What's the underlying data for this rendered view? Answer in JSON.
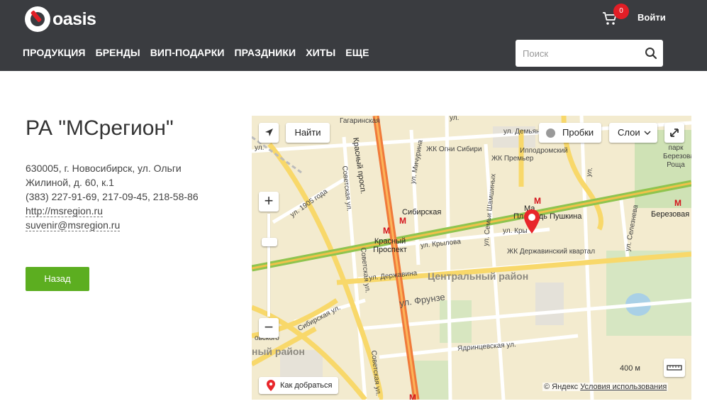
{
  "header": {
    "logo_text": "oasis",
    "cart_count": "0",
    "login_label": "Войти",
    "nav": [
      "ПРОДУКЦИЯ",
      "БРЕНДЫ",
      "ВИП-ПОДАРКИ",
      "ПРАЗДНИКИ",
      "ХИТЫ",
      "ЕЩЕ"
    ],
    "search_placeholder": "Поиск"
  },
  "company": {
    "title": "РА \"МСрегион\"",
    "address_line1": "630005, г. Новосибирск, ул. Ольги",
    "address_line2": "Жилиной, д. 60, к.1",
    "phones": "(383) 227-91-69, 217-09-45, 218-58-86",
    "website": "http://msregion.ru",
    "email": "suvenir@msregion.ru",
    "back_label": "Назад"
  },
  "map": {
    "find_label": "Найти",
    "traffic_label": "Пробки",
    "layers_label": "Слои",
    "route_label": "Как добраться",
    "scale_label": "400 м",
    "copyright": "© Яндекс",
    "terms_label": "Условия использования",
    "district_label": "Центральный район",
    "district2_label": "ный район",
    "streets": {
      "gagarinskaya": "Гагаринская",
      "krasny": "Красный просп.",
      "sibirskaya": "Сибирская",
      "krasny_prospekt": "Красный Проспект",
      "ploshad": "Площадь Пушкина",
      "ploshad_top": "Ма",
      "berezovaya": "Березовая",
      "frunze": "ул. Фрунзе",
      "krylova1": "ул. Крылова",
      "krylova2": "ул. Кры",
      "derzhavina": "ул. Державина",
      "sibirskaya_st": "Сибирская ул.",
      "sovetskaya1": "Советская ул.",
      "sovetskaya2": "Советская ул.",
      "sovetskaya3": "Советская ул.",
      "michurina": "ул. Мичурина",
      "semya": "ул. Семьи Шамшиных",
      "demyana": "ул. Демьяна Бед",
      "ippodromsky": "Ипподромский",
      "ogni": "ЖК Огни Сибири",
      "premier": "ЖК Премьер",
      "derzh_kvartal": "ЖК Державинский квартал",
      "y1905": "ул. 1905 года",
      "selezneva": "ул. Селезнева",
      "yadrintsevskaya": "Ядринцевская ул.",
      "park": "парк Березовая Роща",
      "ul_top": "ул.",
      "ul_left": "ул.",
      "novsk": "овского",
      "ul_right": "ул."
    }
  }
}
